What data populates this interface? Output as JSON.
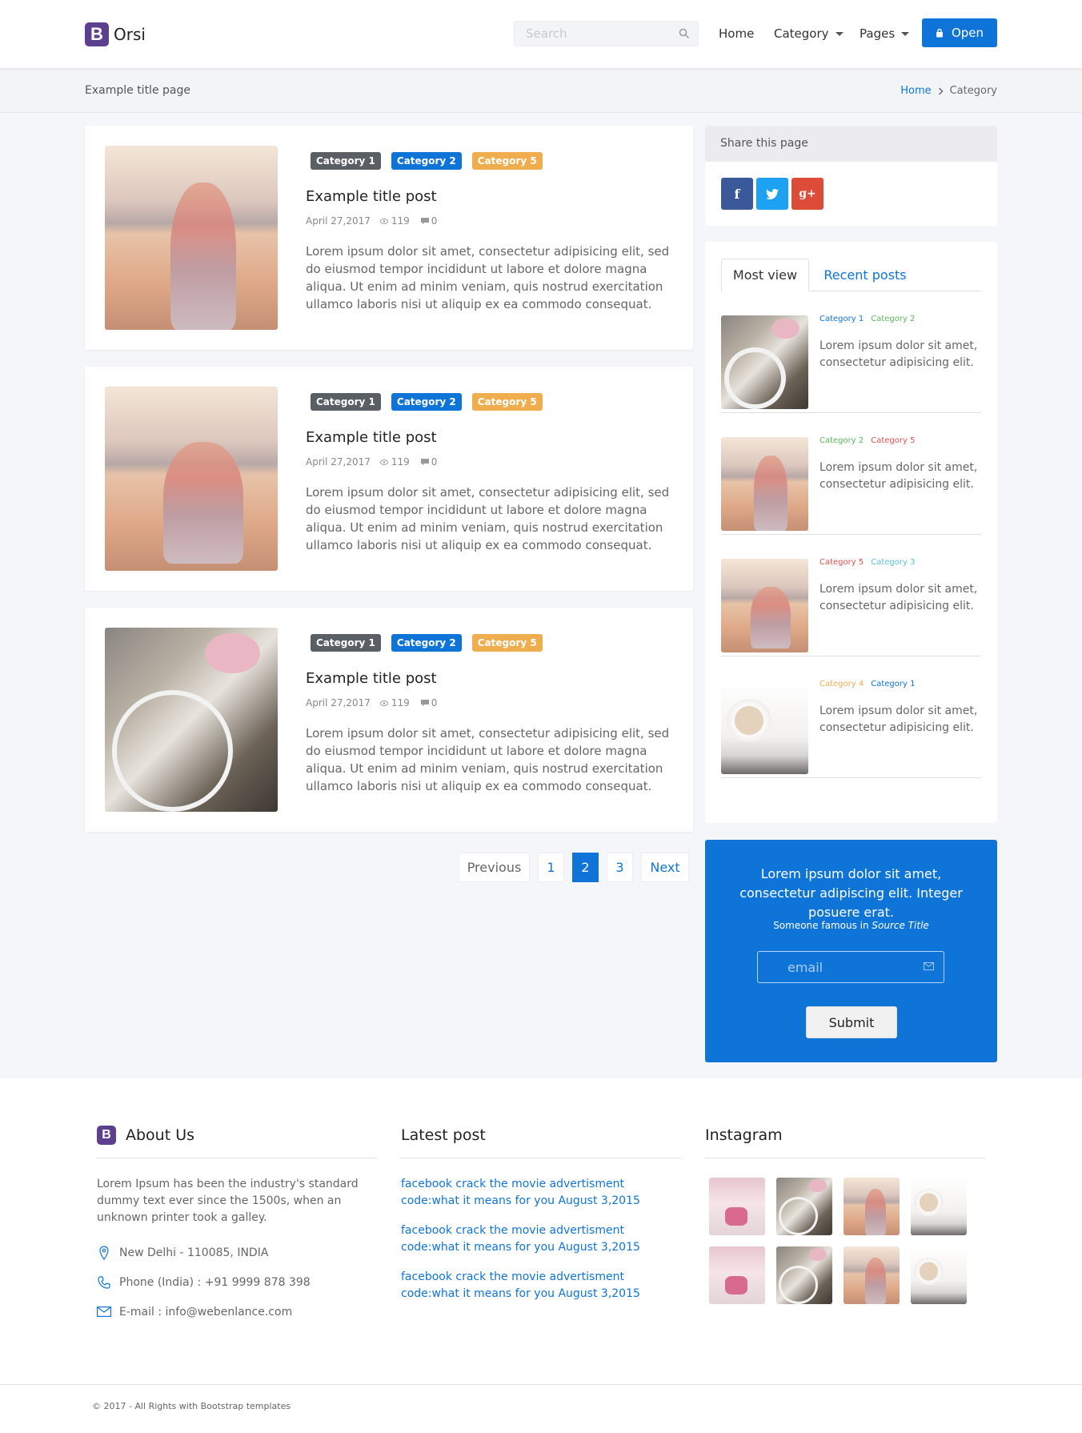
{
  "brand": {
    "logo_letter": "B",
    "name": "Orsi"
  },
  "nav": {
    "search_placeholder": "Search",
    "items": [
      {
        "label": "Home"
      },
      {
        "label": "Category"
      },
      {
        "label": "Pages"
      }
    ],
    "open_label": "Open",
    "accent_color": "#0f74d8"
  },
  "breadcrumb": {
    "page_title": "Example title page",
    "home": "Home",
    "current": "Category"
  },
  "posts": [
    {
      "image": "beach-girl-standing",
      "tags": [
        "Category 1",
        "Category 2",
        "Category 5"
      ],
      "title": "Example title post",
      "date": "April 27,2017",
      "views": "119",
      "comments": "0",
      "excerpt": "Lorem ipsum dolor sit amet, consectetur adipisicing elit, sed do eiusmod tempor incididunt ut labore et dolore magna aliqua. Ut enim ad minim veniam, quis nostrud exercitation ullamco laboris nisi ut aliquip ex ea commodo consequat."
    },
    {
      "image": "beach-girl-sitting",
      "tags": [
        "Category 1",
        "Category 2",
        "Category 5"
      ],
      "title": "Example title post",
      "date": "April 27,2017",
      "views": "119",
      "comments": "0",
      "excerpt": "Lorem ipsum dolor sit amet, consectetur adipisicing elit, sed do eiusmod tempor incididunt ut labore et dolore magna aliqua. Ut enim ad minim veniam, quis nostrud exercitation ullamco laboris nisi ut aliquip ex ea commodo consequat."
    },
    {
      "image": "white-bicycle",
      "tags": [
        "Category 1",
        "Category 2",
        "Category 5"
      ],
      "title": "Example title post",
      "date": "April 27,2017",
      "views": "119",
      "comments": "0",
      "excerpt": "Lorem ipsum dolor sit amet, consectetur adipisicing elit, sed do eiusmod tempor incididunt ut labore et dolore magna aliqua. Ut enim ad minim veniam, quis nostrud exercitation ullamco laboris nisi ut aliquip ex ea commodo consequat."
    }
  ],
  "pagination": {
    "previous": "Previous",
    "pages": [
      "1",
      "2",
      "3"
    ],
    "active": "2",
    "next": "Next"
  },
  "share": {
    "title": "Share this page",
    "networks": [
      "facebook-icon",
      "twitter-icon",
      "google-plus-icon"
    ],
    "fb_glyph": "f",
    "gp_glyph": "g+"
  },
  "tabs": {
    "most_view": "Most view",
    "recent_posts": "Recent posts",
    "items": [
      {
        "image": "white-bicycle",
        "cats": [
          {
            "label": "Category 1",
            "color": "#0f74d8"
          },
          {
            "label": "Category 2",
            "color": "#5cb85c"
          }
        ],
        "text": "Lorem ipsum dolor sit amet, consectetur adipisicing elit."
      },
      {
        "image": "beach-girl-standing",
        "cats": [
          {
            "label": "Category 2",
            "color": "#5cb85c"
          },
          {
            "label": "Category 5",
            "color": "#d9534f"
          }
        ],
        "text": "Lorem ipsum dolor sit amet, consectetur adipisicing elit."
      },
      {
        "image": "beach-girl-sitting",
        "cats": [
          {
            "label": "Category 5",
            "color": "#d9534f"
          },
          {
            "label": "Category 3",
            "color": "#5bc0de"
          }
        ],
        "text": "Lorem ipsum dolor sit amet, consectetur adipisicing elit."
      },
      {
        "image": "coffee-cup",
        "cats": [
          {
            "label": "Category 4",
            "color": "#f0ad4e"
          },
          {
            "label": "Category 1",
            "color": "#0f74d8"
          }
        ],
        "text": "Lorem ipsum dolor sit amet, consectetur adipisicing elit."
      }
    ]
  },
  "newsletter": {
    "quote": "Lorem ipsum dolor sit amet, consectetur adipiscing elit. Integer posuere erat.",
    "cite_prefix": "Someone famous in",
    "cite_source": "Source Title",
    "email_placeholder": "email",
    "submit_label": "Submit"
  },
  "footer": {
    "about": {
      "logo_letter": "B",
      "title": "About Us",
      "text": "Lorem Ipsum has been the industry's standard dummy text ever since the 1500s, when an unknown printer took a galley.",
      "address": "New Delhi - 110085, INDIA",
      "phone": "Phone (India) : +91 9999 878 398",
      "email": "E-mail : info@webenlance.com"
    },
    "latest": {
      "title": "Latest post",
      "links": [
        "facebook crack the movie advertisment code:what it means for you August 3,2015",
        "facebook crack the movie advertisment code:what it means for you August 3,2015",
        "facebook crack the movie advertisment code:what it means for you August 3,2015"
      ]
    },
    "instagram": {
      "title": "Instagram",
      "images": [
        "sweets",
        "white-bicycle",
        "beach-girl-standing",
        "coffee-cup",
        "sweets",
        "white-bicycle",
        "beach-girl-standing",
        "coffee-cup"
      ]
    },
    "copyright": "© 2017 - All Rights with Bootstrap templates"
  }
}
